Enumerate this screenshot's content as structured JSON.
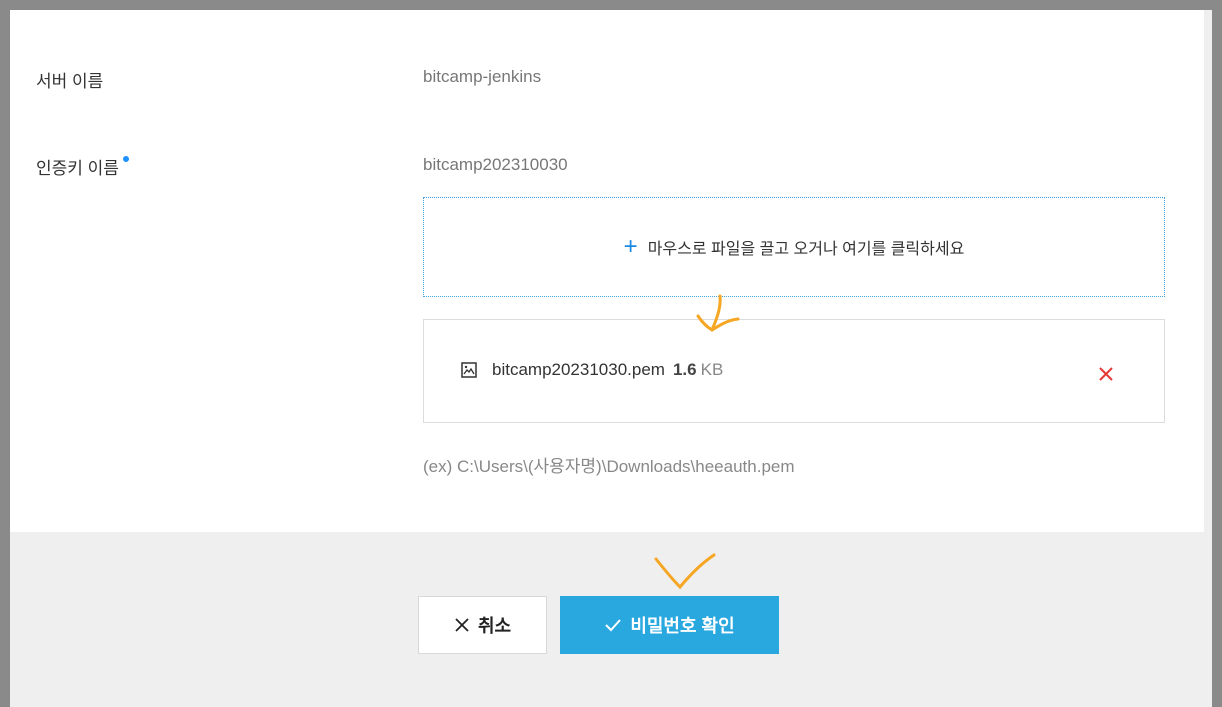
{
  "form": {
    "server_name_label": "서버 이름",
    "server_name_value": "bitcamp-jenkins",
    "auth_key_label": "인증키 이름",
    "auth_key_value": "bitcamp202310030"
  },
  "upload": {
    "dropzone_text": "마우스로 파일을 끌고 오거나 여기를 클릭하세요",
    "file_name": "bitcamp20231030.pem",
    "file_size_value": "1.6",
    "file_size_unit": "KB",
    "hint": "(ex) C:\\Users\\(사용자명)\\Downloads\\heeauth.pem"
  },
  "buttons": {
    "cancel_label": "취소",
    "confirm_label": "비밀번호 확인"
  },
  "colors": {
    "accent": "#29a8e0",
    "required_dot": "#1e90ff",
    "remove_x": "#e53935",
    "annotation": "#f5a623"
  },
  "icons": {
    "dropzone": "plus-icon",
    "file": "image-file-icon",
    "remove": "close-icon",
    "cancel": "close-icon",
    "confirm": "check-icon"
  }
}
